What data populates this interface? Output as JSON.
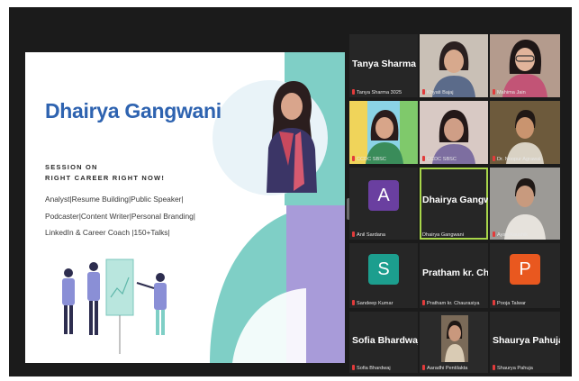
{
  "slide": {
    "presenter_name": "Dhairya Gangwani",
    "session_line1": "SESSION ON",
    "session_line2": "RIGHT CAREER RIGHT NOW!",
    "roles_line1": "Analyst|Resume Building|Public Speaker|",
    "roles_line2": "Podcaster|Content Writer|Personal Branding|",
    "roles_line3": "LinkedIn & Career Coach |150+Talks|"
  },
  "gallery": [
    {
      "big": "Tanya Sharma 3...",
      "caption": "Tanya Sharma 3025"
    },
    {
      "big": "",
      "caption": "Khyati Bajaj"
    },
    {
      "big": "",
      "caption": "Mahima Jain"
    },
    {
      "big": "",
      "caption": "CCDC SBSC"
    },
    {
      "big": "",
      "caption": "CCDC SBSC"
    },
    {
      "big": "",
      "caption": "Dr. Noopur Agrawal"
    },
    {
      "big": "",
      "initial": "A",
      "caption": "Anil Sardana"
    },
    {
      "big": "Dhairya Gangw...",
      "caption": "Dhairya Gangwani"
    },
    {
      "big": "",
      "caption": "Ayan Kaushik"
    },
    {
      "big": "",
      "initial": "S",
      "caption": "Sandeep Kumar"
    },
    {
      "big": "Pratham kr. Cha...",
      "caption": "Pratham kr. Chaurasiya"
    },
    {
      "big": "",
      "initial": "P",
      "caption": "Pooja Talwar"
    },
    {
      "big": "Sofia Bhardwaj",
      "caption": "Sofia Bhardwaj"
    },
    {
      "big": "",
      "caption": "Aaradhi Pentilakta"
    },
    {
      "big": "Shaurya Pahuja",
      "caption": "Shaurya Pahuja"
    }
  ],
  "colors": {
    "teal": "#7fcfc6",
    "lavender": "#a89bd9",
    "name_blue": "#2e63b0",
    "avatar_purple": "#6a3fa0",
    "avatar_teal": "#1c9e8e",
    "avatar_orange": "#e9581f",
    "active_outline": "#a8d64a"
  }
}
